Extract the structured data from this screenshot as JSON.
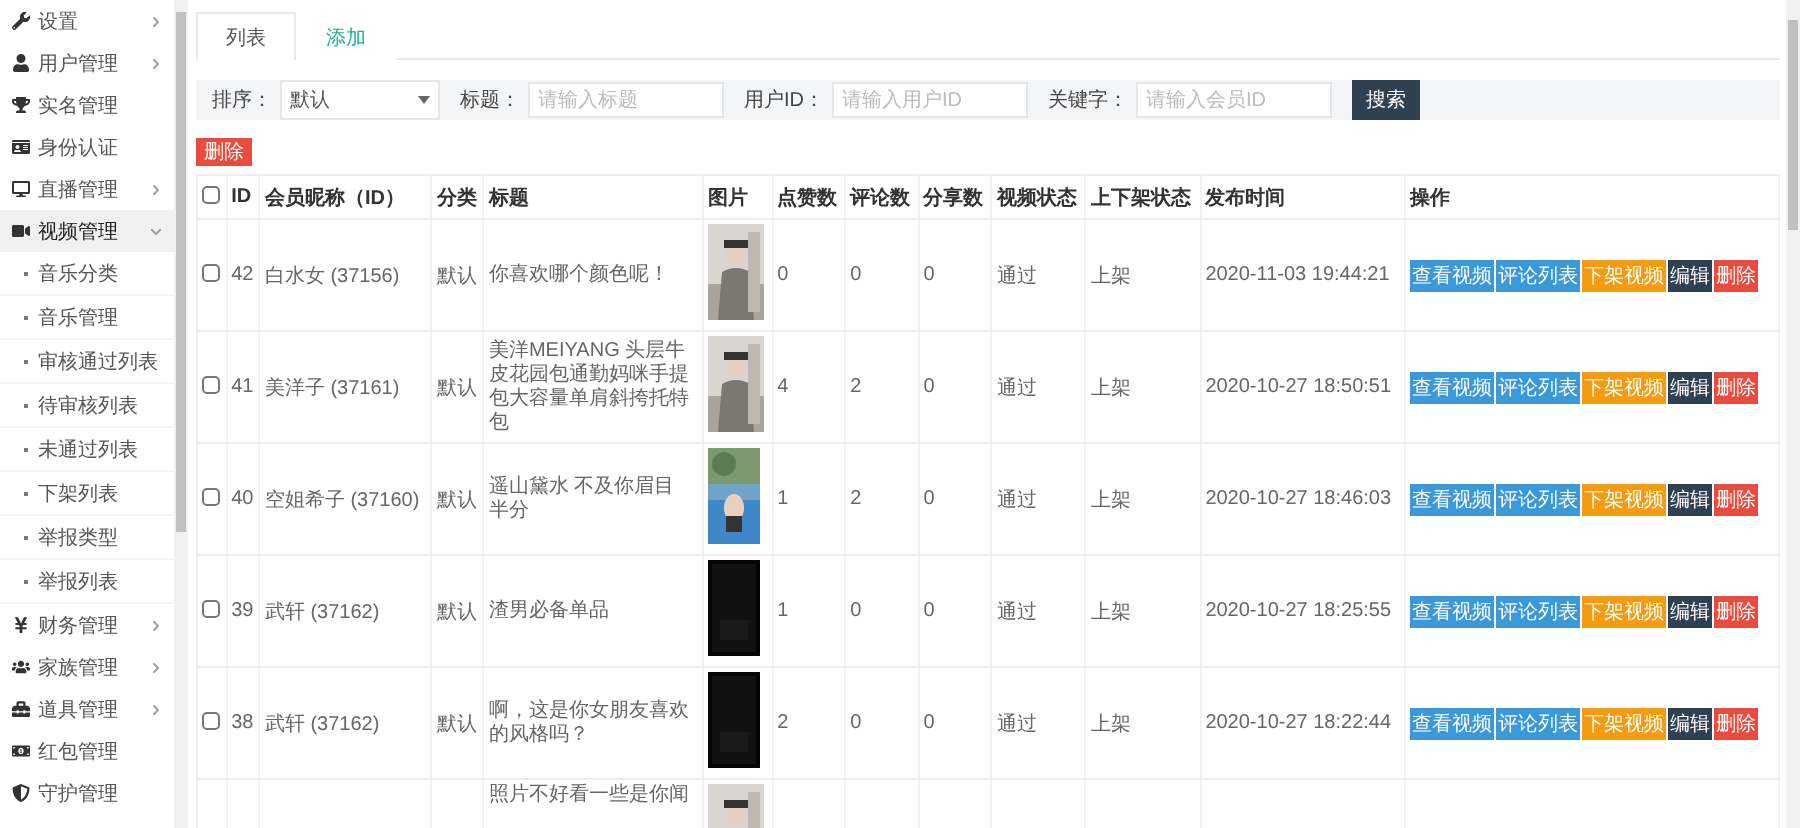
{
  "sidebar": {
    "items": [
      {
        "label": "设置",
        "expandable": true,
        "selected": false
      },
      {
        "label": "用户管理",
        "expandable": true,
        "selected": false
      },
      {
        "label": "实名管理",
        "expandable": false,
        "selected": false
      },
      {
        "label": "身份认证",
        "expandable": false,
        "selected": false
      },
      {
        "label": "直播管理",
        "expandable": true,
        "selected": false
      },
      {
        "label": "视频管理",
        "expandable": true,
        "selected": true,
        "expanded": true,
        "children": [
          {
            "label": "音乐分类"
          },
          {
            "label": "音乐管理"
          },
          {
            "label": "审核通过列表"
          },
          {
            "label": "待审核列表"
          },
          {
            "label": "未通过列表"
          },
          {
            "label": "下架列表"
          },
          {
            "label": "举报类型"
          },
          {
            "label": "举报列表"
          }
        ]
      },
      {
        "label": "财务管理",
        "expandable": true,
        "selected": false
      },
      {
        "label": "家族管理",
        "expandable": true,
        "selected": false
      },
      {
        "label": "道具管理",
        "expandable": true,
        "selected": false
      },
      {
        "label": "红包管理",
        "expandable": false,
        "selected": false
      },
      {
        "label": "守护管理",
        "expandable": false,
        "selected": false
      }
    ]
  },
  "tabs": [
    {
      "label": "列表",
      "selected": true
    },
    {
      "label": "添加",
      "selected": false
    }
  ],
  "search": {
    "fields": [
      {
        "kind": "select",
        "label": "排序：",
        "value": "默认"
      },
      {
        "kind": "input",
        "label": "标题：",
        "placeholder": "请输入标题"
      },
      {
        "kind": "input",
        "label": "用户ID：",
        "placeholder": "请输入用户ID"
      },
      {
        "kind": "input",
        "label": "关键字：",
        "placeholder": "请输入会员ID"
      }
    ],
    "button": "搜索"
  },
  "bulk_delete": "删除",
  "table": {
    "select_all": {
      "checked": false
    },
    "columns": [
      "ID",
      "会员昵称（ID）",
      "分类",
      "标题",
      "图片",
      "点赞数",
      "评论数",
      "分享数",
      "视频状态",
      "上下架状态",
      "发布时间",
      "操作"
    ],
    "rows": [
      {
        "checked": false,
        "id": "42",
        "member": "白水女 (37156)",
        "category": "默认",
        "title": "你喜欢哪个颜色呢！",
        "picture": {
          "kind": "picture"
        },
        "likes": "0",
        "comments": "0",
        "shares": "0",
        "status": "通过",
        "shelf": "上架",
        "time": "2020-11-03 19:44:21",
        "actions": [
          {
            "label": "查看视频",
            "color": "#3a99d8"
          },
          {
            "label": "评论列表",
            "color": "#3a99d8"
          },
          {
            "label": "下架视频",
            "color": "#f39c12"
          },
          {
            "label": "编辑",
            "color": "#2f4050"
          },
          {
            "label": "删除",
            "color": "#e74c3c"
          }
        ]
      },
      {
        "checked": false,
        "id": "41",
        "member": "美洋子 (37161)",
        "category": "默认",
        "title": "美洋MEIYANG 头层牛皮花园包通勤妈咪手提包大容量单肩斜挎托特包",
        "picture": {
          "kind": "picture"
        },
        "likes": "4",
        "comments": "2",
        "shares": "0",
        "status": "通过",
        "shelf": "上架",
        "time": "2020-10-27 18:50:51",
        "actions": [
          {
            "label": "查看视频",
            "color": "#3a99d8"
          },
          {
            "label": "评论列表",
            "color": "#3a99d8"
          },
          {
            "label": "下架视频",
            "color": "#f39c12"
          },
          {
            "label": "编辑",
            "color": "#2f4050"
          },
          {
            "label": "删除",
            "color": "#e74c3c"
          }
        ]
      },
      {
        "checked": false,
        "id": "40",
        "member": "空姐希子 (37160)",
        "category": "默认",
        "title": "遥山黛水 不及你眉目半分",
        "picture": {
          "kind": "picture"
        },
        "likes": "1",
        "comments": "2",
        "shares": "0",
        "status": "通过",
        "shelf": "上架",
        "time": "2020-10-27 18:46:03",
        "actions": [
          {
            "label": "查看视频",
            "color": "#3a99d8"
          },
          {
            "label": "评论列表",
            "color": "#3a99d8"
          },
          {
            "label": "下架视频",
            "color": "#f39c12"
          },
          {
            "label": "编辑",
            "color": "#2f4050"
          },
          {
            "label": "删除",
            "color": "#e74c3c"
          }
        ]
      },
      {
        "checked": false,
        "id": "39",
        "member": "武轩 (37162)",
        "category": "默认",
        "title": "渣男必备单品",
        "picture": {
          "kind": "picture"
        },
        "likes": "1",
        "comments": "0",
        "shares": "0",
        "status": "通过",
        "shelf": "上架",
        "time": "2020-10-27 18:25:55",
        "actions": [
          {
            "label": "查看视频",
            "color": "#3a99d8"
          },
          {
            "label": "评论列表",
            "color": "#3a99d8"
          },
          {
            "label": "下架视频",
            "color": "#f39c12"
          },
          {
            "label": "编辑",
            "color": "#2f4050"
          },
          {
            "label": "删除",
            "color": "#e74c3c"
          }
        ]
      },
      {
        "checked": false,
        "id": "38",
        "member": "武轩 (37162)",
        "category": "默认",
        "title": "啊，这是你女朋友喜欢的风格吗？",
        "picture": {
          "kind": "picture"
        },
        "likes": "2",
        "comments": "0",
        "shares": "0",
        "status": "通过",
        "shelf": "上架",
        "time": "2020-10-27 18:22:44",
        "actions": [
          {
            "label": "查看视频",
            "color": "#3a99d8"
          },
          {
            "label": "评论列表",
            "color": "#3a99d8"
          },
          {
            "label": "下架视频",
            "color": "#f39c12"
          },
          {
            "label": "编辑",
            "color": "#2f4050"
          },
          {
            "label": "删除",
            "color": "#e74c3c"
          }
        ]
      },
      {
        "title": "照片不好看一些是你闻",
        "picture": {
          "kind": "picture"
        }
      }
    ]
  }
}
